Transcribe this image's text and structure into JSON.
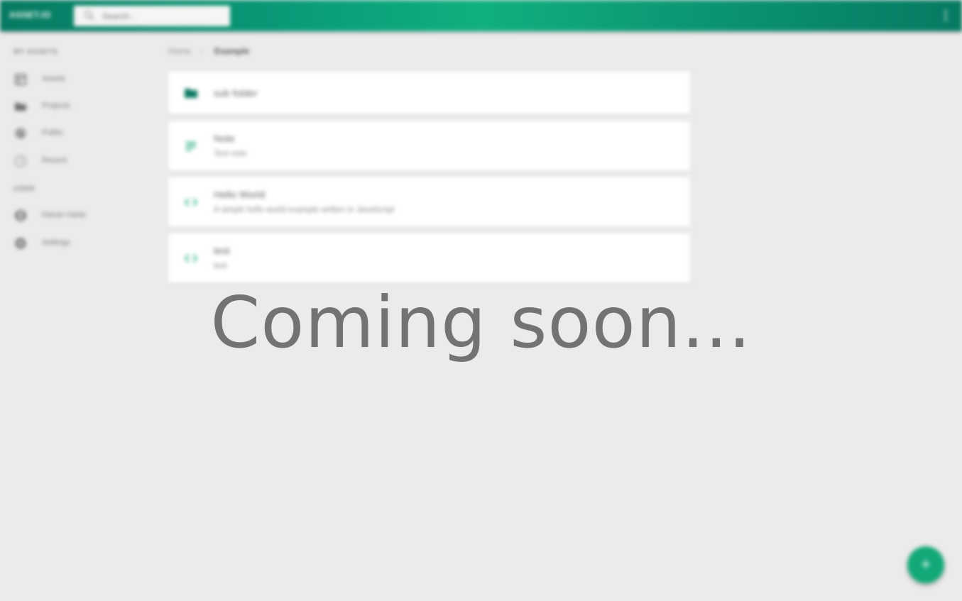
{
  "app": {
    "brand": "ASSET.IO"
  },
  "search": {
    "placeholder": "Search..."
  },
  "sidebar": {
    "sections": [
      {
        "title": "MY ASSETS",
        "items": [
          {
            "label": "Assets",
            "icon": "assets-icon"
          },
          {
            "label": "Projects",
            "icon": "folder-icon"
          },
          {
            "label": "Public",
            "icon": "globe-icon"
          },
          {
            "label": "Recent",
            "icon": "clock-icon"
          }
        ]
      },
      {
        "title": "USER",
        "items": [
          {
            "label": "Kieran Harte",
            "icon": "user-icon"
          },
          {
            "label": "Settings",
            "icon": "gear-icon"
          }
        ]
      }
    ]
  },
  "breadcrumb": {
    "home": "Home",
    "separator": "›",
    "current": "Example"
  },
  "items": [
    {
      "type": "folder",
      "icon": "folder-icon",
      "title": "sub folder",
      "subtitle": ""
    },
    {
      "type": "note",
      "icon": "note-icon",
      "title": "Note",
      "subtitle": "Test note"
    },
    {
      "type": "code",
      "icon": "code-icon",
      "title": "Hello World",
      "subtitle": "A simple hello world example written in JavaScript"
    },
    {
      "type": "code",
      "icon": "code-icon",
      "title": "test",
      "subtitle": "test"
    }
  ],
  "fab": {
    "label": "+"
  },
  "overlay": {
    "text": "Coming soon..."
  },
  "colors": {
    "accent": "#0aa07c",
    "accent_dark": "#067a62",
    "background": "#ebebeb",
    "fab": "#12a878"
  }
}
